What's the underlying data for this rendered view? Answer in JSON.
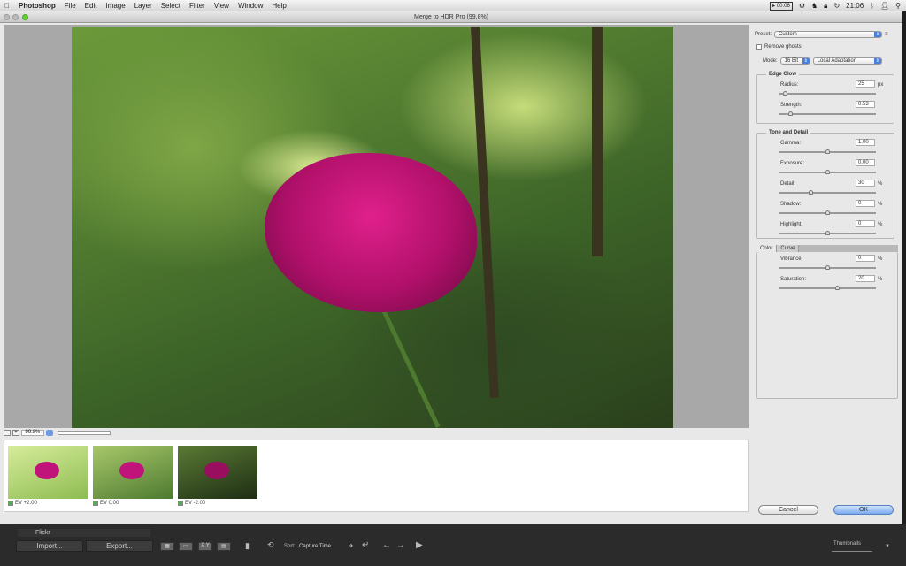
{
  "menubar": {
    "app": "Photoshop",
    "items": [
      "File",
      "Edit",
      "Image",
      "Layer",
      "Select",
      "Filter",
      "View",
      "Window",
      "Help"
    ],
    "recording": "▸ 00:06",
    "clock": "21:06"
  },
  "window": {
    "title": "Merge to HDR Pro (99.8%)"
  },
  "zoom": {
    "value": "99.8%",
    "minus": "-",
    "plus": "+"
  },
  "thumbnails": [
    {
      "label": "EV +2.00",
      "checked": true
    },
    {
      "label": "EV 0.00",
      "checked": true
    },
    {
      "label": "EV -2.00",
      "checked": true
    }
  ],
  "panel": {
    "preset_label": "Preset:",
    "preset_value": "Custom",
    "remove_ghosts": "Remove ghosts",
    "mode_label": "Mode:",
    "mode_bits": "16 Bit",
    "mode_method": "Local Adaptation",
    "edge_glow": {
      "title": "Edge Glow",
      "radius": {
        "label": "Radius:",
        "value": "25",
        "unit": "px",
        "pos": 0.06
      },
      "strength": {
        "label": "Strength:",
        "value": "0.53",
        "pos": 0.12
      }
    },
    "tone": {
      "title": "Tone and Detail",
      "gamma": {
        "label": "Gamma:",
        "value": "1.00",
        "pos": 0.5
      },
      "exposure": {
        "label": "Exposure:",
        "value": "0.00",
        "pos": 0.5
      },
      "detail": {
        "label": "Detail:",
        "value": "30",
        "unit": "%",
        "pos": 0.33
      },
      "shadow": {
        "label": "Shadow:",
        "value": "0",
        "unit": "%",
        "pos": 0.5
      },
      "highlight": {
        "label": "Highlight:",
        "value": "0",
        "unit": "%",
        "pos": 0.5
      }
    },
    "tabs": [
      "Color",
      "Curve"
    ],
    "color": {
      "vibrance": {
        "label": "Vibrance:",
        "value": "0",
        "unit": "%",
        "pos": 0.5
      },
      "saturation": {
        "label": "Saturation:",
        "value": "20",
        "unit": "%",
        "pos": 0.6
      }
    },
    "cancel": "Cancel",
    "ok": "OK"
  },
  "lightroom": {
    "collection": "Flickr",
    "import": "Import...",
    "export": "Export...",
    "sort_label": "Sort:",
    "sort_value": "Capture Time",
    "thumbnails_label": "Thumbnails",
    "xy": "X Y"
  }
}
